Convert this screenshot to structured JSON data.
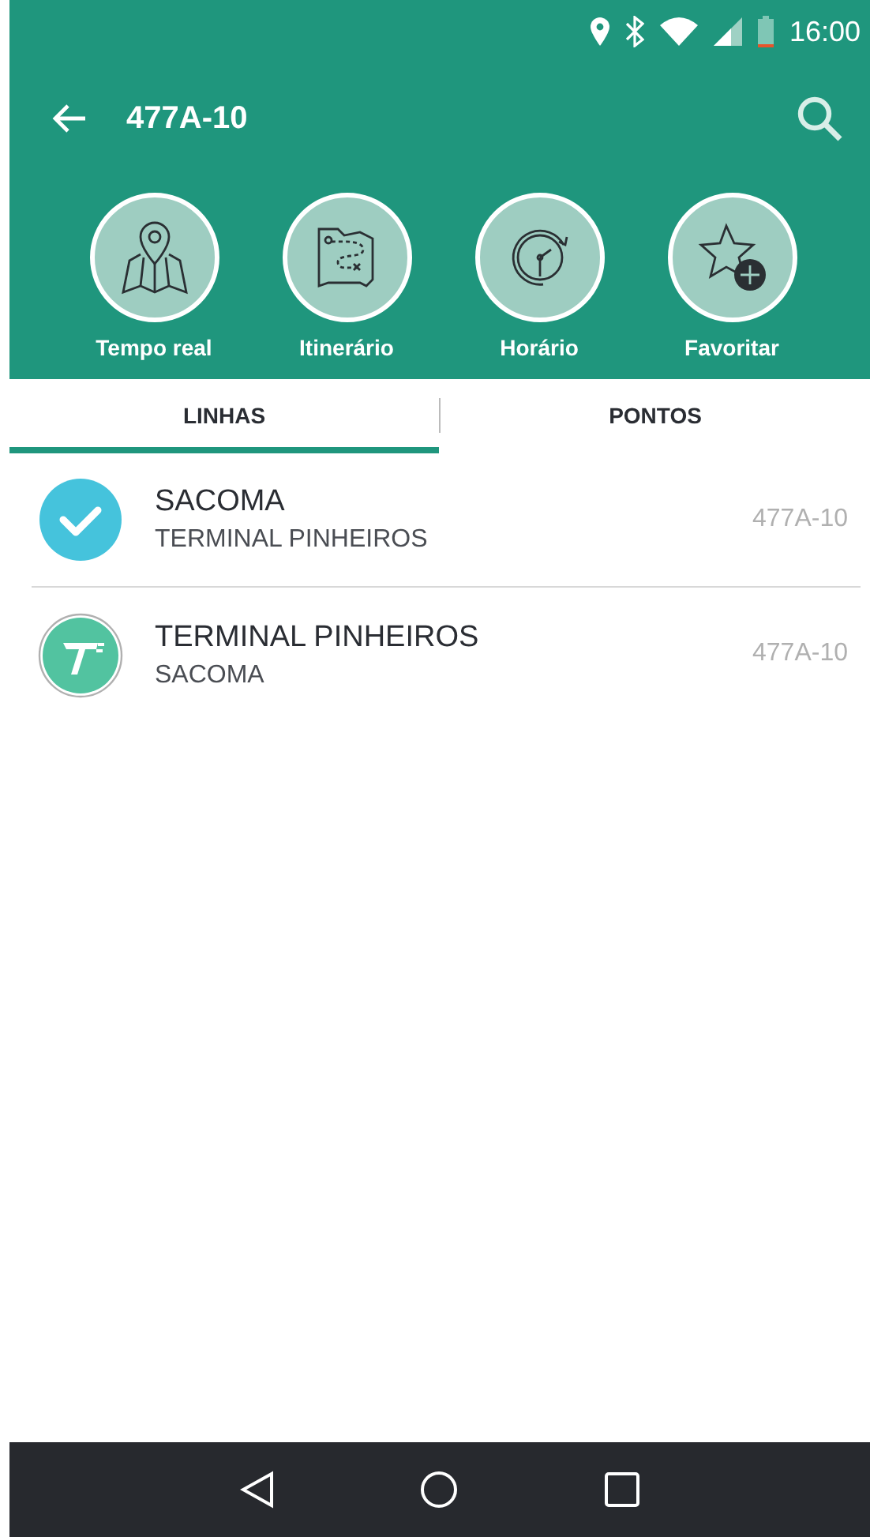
{
  "status_bar": {
    "time": "16:00"
  },
  "toolbar": {
    "title": "477A-10"
  },
  "actions": [
    {
      "label": "Tempo real",
      "kind": "map"
    },
    {
      "label": "Itinerário",
      "kind": "route"
    },
    {
      "label": "Horário",
      "kind": "clock"
    },
    {
      "label": "Favoritar",
      "kind": "favorite"
    }
  ],
  "tabs": [
    {
      "label": "LINHAS",
      "selected": true
    },
    {
      "label": "PONTOS",
      "selected": false
    }
  ],
  "rows": [
    {
      "title": "SACOMA",
      "subtitle": "TERMINAL PINHEIROS",
      "code": "477A-10",
      "selected": true
    },
    {
      "title": "TERMINAL PINHEIROS",
      "subtitle": "SACOMA",
      "code": "477A-10",
      "selected": false
    }
  ]
}
